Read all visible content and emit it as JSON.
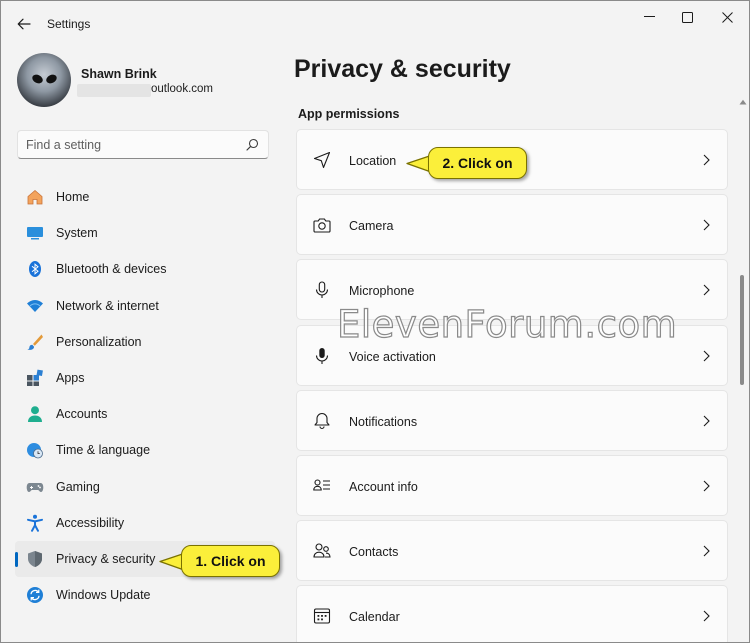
{
  "window": {
    "title": "Settings"
  },
  "profile": {
    "name": "Shawn Brink",
    "email_visible": "outlook.com"
  },
  "search": {
    "placeholder": "Find a setting"
  },
  "sidebar": {
    "items": [
      {
        "label": "Home",
        "icon": "home-icon"
      },
      {
        "label": "System",
        "icon": "system-icon"
      },
      {
        "label": "Bluetooth & devices",
        "icon": "bluetooth-icon"
      },
      {
        "label": "Network & internet",
        "icon": "wifi-icon"
      },
      {
        "label": "Personalization",
        "icon": "brush-icon"
      },
      {
        "label": "Apps",
        "icon": "apps-icon"
      },
      {
        "label": "Accounts",
        "icon": "person-icon"
      },
      {
        "label": "Time & language",
        "icon": "clock-globe-icon"
      },
      {
        "label": "Gaming",
        "icon": "gamepad-icon"
      },
      {
        "label": "Accessibility",
        "icon": "accessibility-icon"
      },
      {
        "label": "Privacy & security",
        "icon": "shield-icon",
        "active": true
      },
      {
        "label": "Windows Update",
        "icon": "update-icon"
      }
    ]
  },
  "main": {
    "title": "Privacy & security",
    "section": "App permissions",
    "cards": [
      {
        "label": "Location",
        "icon": "location-arrow-icon"
      },
      {
        "label": "Camera",
        "icon": "camera-icon"
      },
      {
        "label": "Microphone",
        "icon": "microphone-icon"
      },
      {
        "label": "Voice activation",
        "icon": "voice-mic-icon"
      },
      {
        "label": "Notifications",
        "icon": "bell-icon"
      },
      {
        "label": "Account info",
        "icon": "account-info-icon"
      },
      {
        "label": "Contacts",
        "icon": "contacts-icon"
      },
      {
        "label": "Calendar",
        "icon": "calendar-icon"
      }
    ]
  },
  "callouts": {
    "step1": "1. Click on",
    "step2": "2. Click on"
  },
  "watermark": "ElevenForum.com",
  "colors": {
    "accent": "#0067c0",
    "callout": "#fbef3a",
    "background": "#f3f3f3",
    "card": "#fbfbfb"
  }
}
